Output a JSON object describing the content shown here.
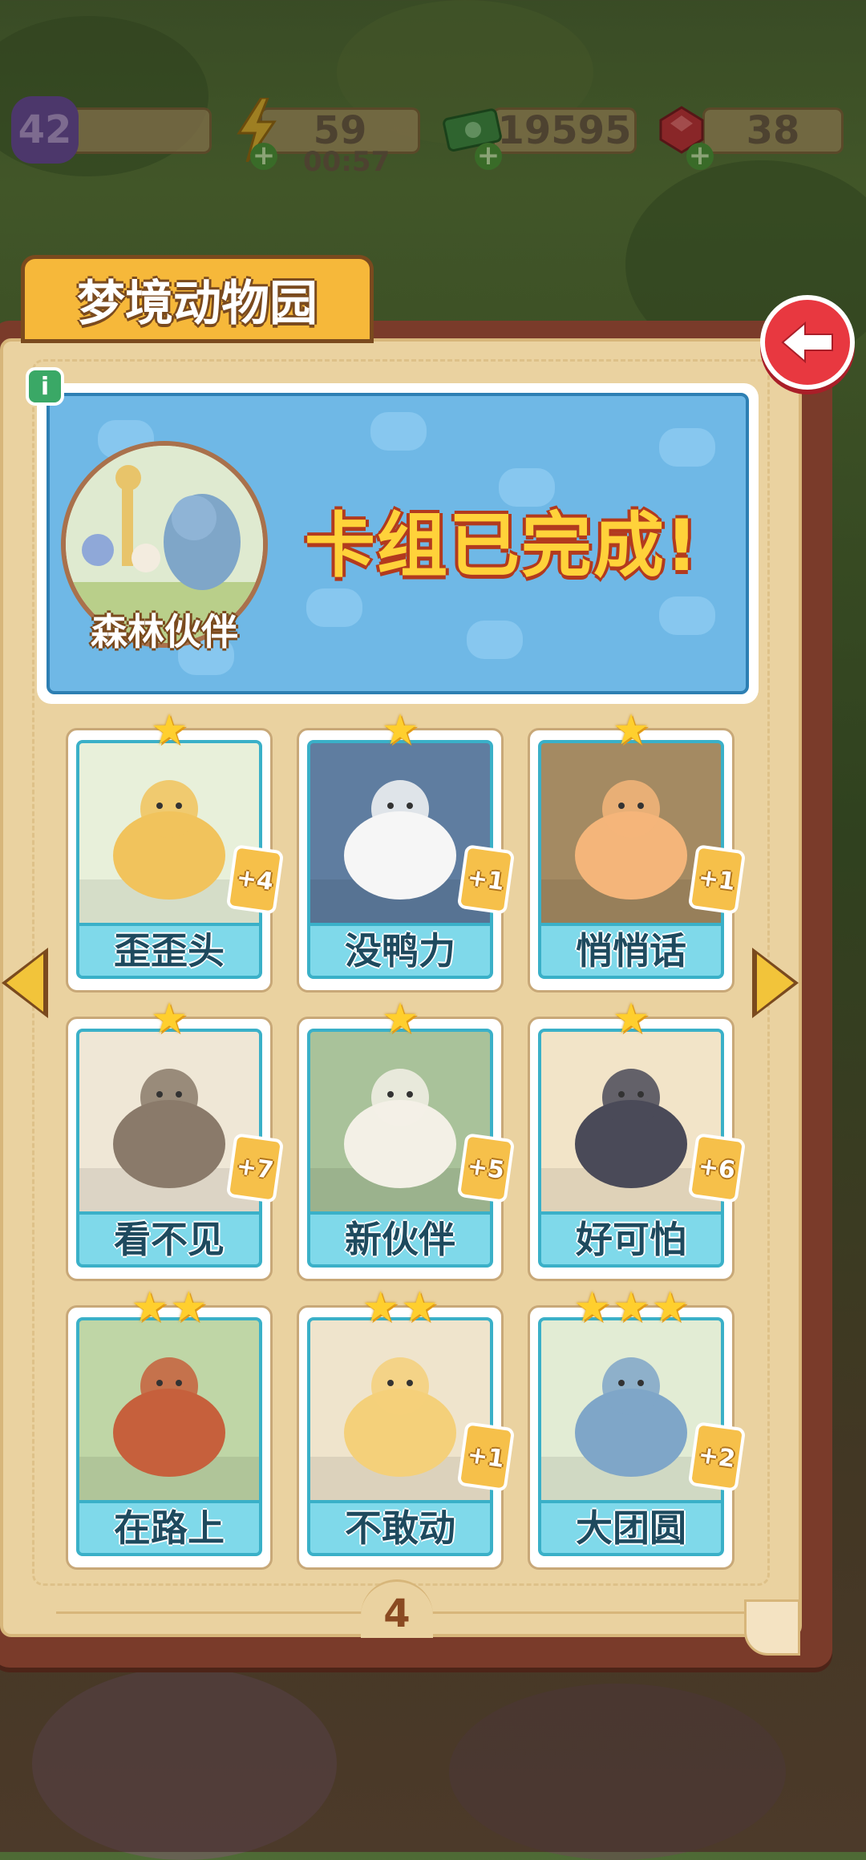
{
  "hud": {
    "level": "42",
    "energy": "59",
    "energy_timer": "00:57",
    "cash": "19595",
    "gems": "38"
  },
  "title": "梦境动物园",
  "deck": {
    "name": "森林伙伴",
    "status": "卡组已完成!"
  },
  "cards": [
    {
      "name": "歪歪头",
      "stars": 1,
      "count": "+4"
    },
    {
      "name": "没鸭力",
      "stars": 1,
      "count": "+1"
    },
    {
      "name": "悄悄话",
      "stars": 1,
      "count": "+1"
    },
    {
      "name": "看不见",
      "stars": 1,
      "count": "+7"
    },
    {
      "name": "新伙伴",
      "stars": 1,
      "count": "+5"
    },
    {
      "name": "好可怕",
      "stars": 1,
      "count": "+6"
    },
    {
      "name": "在路上",
      "stars": 2,
      "count": ""
    },
    {
      "name": "不敢动",
      "stars": 2,
      "count": "+1"
    },
    {
      "name": "大团圆",
      "stars": 3,
      "count": "+2"
    }
  ],
  "page_number": "4",
  "colors": {
    "accent": "#f6b83a",
    "card_label": "#7fd9ea",
    "banner": "#6fb8e6",
    "back_button": "#e83840"
  }
}
